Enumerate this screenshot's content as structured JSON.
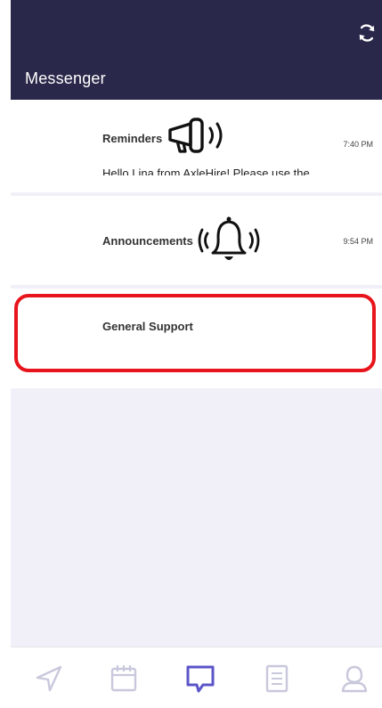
{
  "header": {
    "title": "Messenger",
    "refresh_icon": "refresh-icon"
  },
  "conversations": [
    {
      "name": "Reminders",
      "time": "7:40 PM",
      "preview": "Hello Lina from AxleHire! Please use the",
      "icon": "megaphone-icon"
    },
    {
      "name": "Announcements",
      "time": "9:54 PM",
      "preview": "",
      "icon": "bell-ringing-icon"
    },
    {
      "name": "General Support",
      "time": "",
      "preview": "",
      "icon": ""
    }
  ],
  "highlight_color": "#e8141b",
  "colors": {
    "header_bg": "#29284a",
    "nav_active": "#5b55c8",
    "nav_inactive": "#c9c8dc"
  },
  "footer": {
    "items": [
      {
        "icon": "navigation-arrow-icon",
        "active": false
      },
      {
        "icon": "calendar-icon",
        "active": false
      },
      {
        "icon": "chat-icon",
        "active": true
      },
      {
        "icon": "document-list-icon",
        "active": false
      },
      {
        "icon": "profile-icon",
        "active": false
      }
    ]
  }
}
